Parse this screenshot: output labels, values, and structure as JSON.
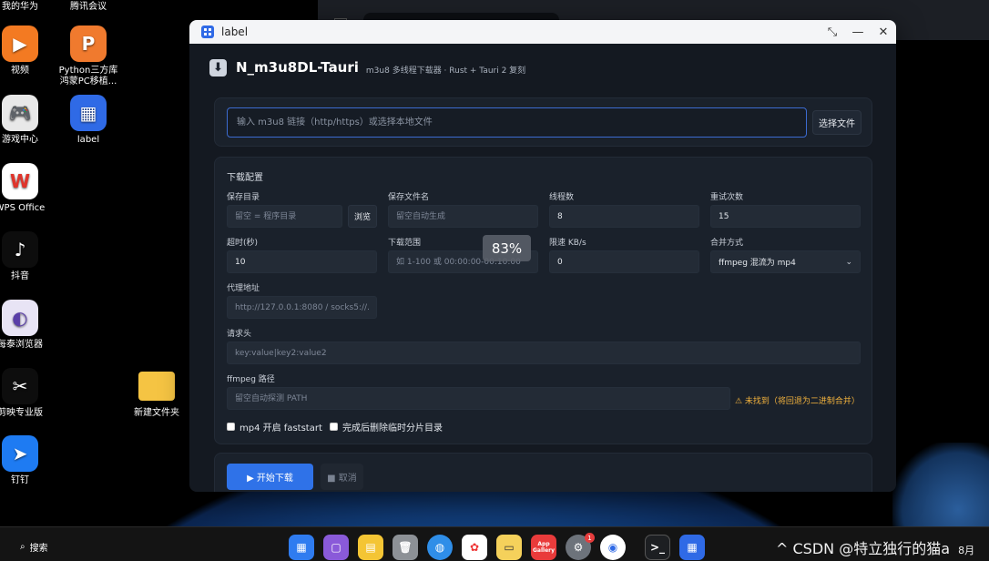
{
  "desktop": {
    "top_labels": [
      "我的华为",
      "腾讯会议"
    ],
    "icons": [
      {
        "label": "视频",
        "icon": "video-play-icon",
        "color": "#f37a22"
      },
      {
        "label": "Python三方库\n鸿蒙PC移植...",
        "icon": "powerpoint-p-icon",
        "color": "#f07a2e"
      },
      {
        "label": "游戏中心",
        "icon": "gamepad-icon",
        "color": "#e8e8e8"
      },
      {
        "label": "label",
        "icon": "label-app-icon",
        "color": "#2f6ae6"
      },
      {
        "label": "WPS Office",
        "icon": "wps-icon",
        "color": "#ffffff"
      },
      {
        "label": "抖音",
        "icon": "tiktok-icon",
        "color": "#0d0d0d"
      },
      {
        "label": "每泰浏览器",
        "icon": "browser-icon",
        "color": "#5a3fa8"
      },
      {
        "label": "剪映专业版",
        "icon": "capcut-icon",
        "color": "#0d0d0d"
      },
      {
        "label": "新建文件夹",
        "icon": "folder-icon",
        "color": "#f5c443"
      },
      {
        "label": "钉钉",
        "icon": "dingtalk-icon",
        "color": "#1e7bf2"
      }
    ]
  },
  "window": {
    "title": "label",
    "controls": {
      "restore": "⤡",
      "minimize": "—",
      "close": "✕"
    }
  },
  "header": {
    "icon": "⬇",
    "title": "N_m3u8DL-Tauri",
    "subtitle": "m3u8 多线程下载器 · Rust + Tauri 2 复刻"
  },
  "source": {
    "placeholder": "输入 m3u8 链接（http/https）或选择本地文件",
    "select_file_label": "选择文件"
  },
  "config": {
    "title": "下载配置",
    "save_dir": {
      "label": "保存目录",
      "placeholder": "留空 = 程序目录",
      "browse_label": "浏览"
    },
    "save_name": {
      "label": "保存文件名",
      "placeholder": "留空自动生成"
    },
    "threads": {
      "label": "线程数",
      "value": "8"
    },
    "retries": {
      "label": "重试次数",
      "value": "15"
    },
    "timeout": {
      "label": "超时(秒)",
      "value": "10"
    },
    "range": {
      "label": "下载范围",
      "placeholder": "如 1-100 或 00:00:00-00:10:00"
    },
    "rate_limit": {
      "label": "限速 KB/s",
      "value": "0"
    },
    "merge": {
      "label": "合并方式",
      "value": "ffmpeg 混流为 mp4"
    },
    "proxy": {
      "label": "代理地址",
      "placeholder": "http://127.0.0.1:8080 / socks5://..."
    },
    "headers": {
      "label": "请求头",
      "placeholder": "key:value|key2:value2"
    },
    "ffmpeg": {
      "label": "ffmpeg 路径",
      "placeholder": "留空自动探测 PATH",
      "warning": "⚠ 未找到（将回退为二进制合并）"
    },
    "faststart_label": "mp4 开启 faststart",
    "cleanup_label": "完成后删除临时分片目录"
  },
  "zoom_badge": "83%",
  "actions": {
    "start_label": "▶ 开始下载",
    "cancel_label": "■ 取消"
  },
  "taskbar": {
    "search_label": "搜索",
    "notification_count": "1",
    "tray_text": "^ CSDN @特立独行的猫a",
    "date_partial": "8月",
    "app_gallery_label": "App Gallery"
  }
}
